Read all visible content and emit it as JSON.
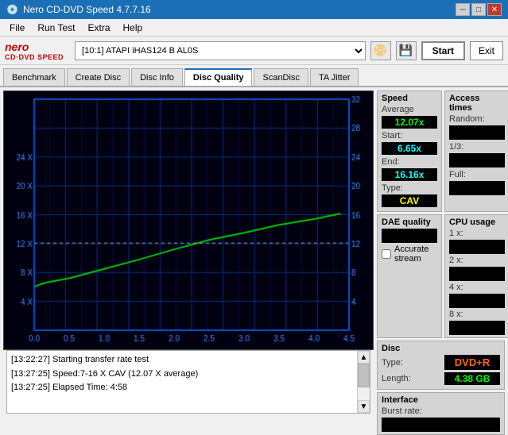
{
  "titleBar": {
    "title": "Nero CD-DVD Speed 4.7.7.16",
    "controls": [
      "minimize",
      "maximize",
      "close"
    ]
  },
  "menuBar": {
    "items": [
      "File",
      "Run Test",
      "Extra",
      "Help"
    ]
  },
  "toolbar": {
    "logo": "Nero CD·DVD SPEED",
    "driveLabel": "[10:1]  ATAPI iHAS124  B AL0S",
    "startLabel": "Start",
    "exitLabel": "Exit"
  },
  "tabs": [
    {
      "label": "Benchmark",
      "active": false
    },
    {
      "label": "Create Disc",
      "active": false
    },
    {
      "label": "Disc Info",
      "active": false
    },
    {
      "label": "Disc Quality",
      "active": true
    },
    {
      "label": "ScanDisc",
      "active": false
    },
    {
      "label": "TA Jitter",
      "active": false
    }
  ],
  "speed": {
    "sectionTitle": "Speed",
    "avgLabel": "Average",
    "avgValue": "12.07x",
    "startLabel": "Start:",
    "startValue": "6.65x",
    "endLabel": "End:",
    "endValue": "16.16x",
    "typeLabel": "Type:",
    "typeValue": "CAV"
  },
  "daeQuality": {
    "sectionTitle": "DAE quality",
    "value": "",
    "accurateStreamLabel": "Accurate stream"
  },
  "discInfo": {
    "sectionTitle": "Disc",
    "typeLabel": "Type:",
    "typeValue": "DVD+R",
    "lengthLabel": "Length:",
    "lengthValue": "4.38 GB"
  },
  "accessTimes": {
    "sectionTitle": "Access times",
    "randomLabel": "Random:",
    "randomValue": "",
    "oneThirdLabel": "1/3:",
    "oneThirdValue": "",
    "fullLabel": "Full:",
    "fullValue": ""
  },
  "cpuUsage": {
    "sectionTitle": "CPU usage",
    "1xLabel": "1 x:",
    "1xValue": "",
    "2xLabel": "2 x:",
    "2xValue": "",
    "4xLabel": "4 x:",
    "4xValue": "",
    "8xLabel": "8 x:",
    "8xValue": ""
  },
  "interface": {
    "sectionTitle": "Interface",
    "burstRateLabel": "Burst rate:",
    "burstRateValue": ""
  },
  "log": {
    "lines": [
      "[13:22:27]  Starting transfer rate test",
      "[13:27:25]  Speed:7-16 X CAV (12.07 X average)",
      "[13:27:25]  Elapsed Time: 4:58"
    ]
  },
  "graph": {
    "xLabels": [
      "0.0",
      "0.5",
      "1.0",
      "1.5",
      "2.0",
      "2.5",
      "3.0",
      "3.5",
      "4.0",
      "4.5"
    ],
    "yLeftLabels": [
      "4 X",
      "8 X",
      "12 X",
      "16 X",
      "20 X",
      "24 X"
    ],
    "yRightLabels": [
      "4",
      "8",
      "12",
      "16",
      "20",
      "24",
      "28",
      "32"
    ]
  }
}
